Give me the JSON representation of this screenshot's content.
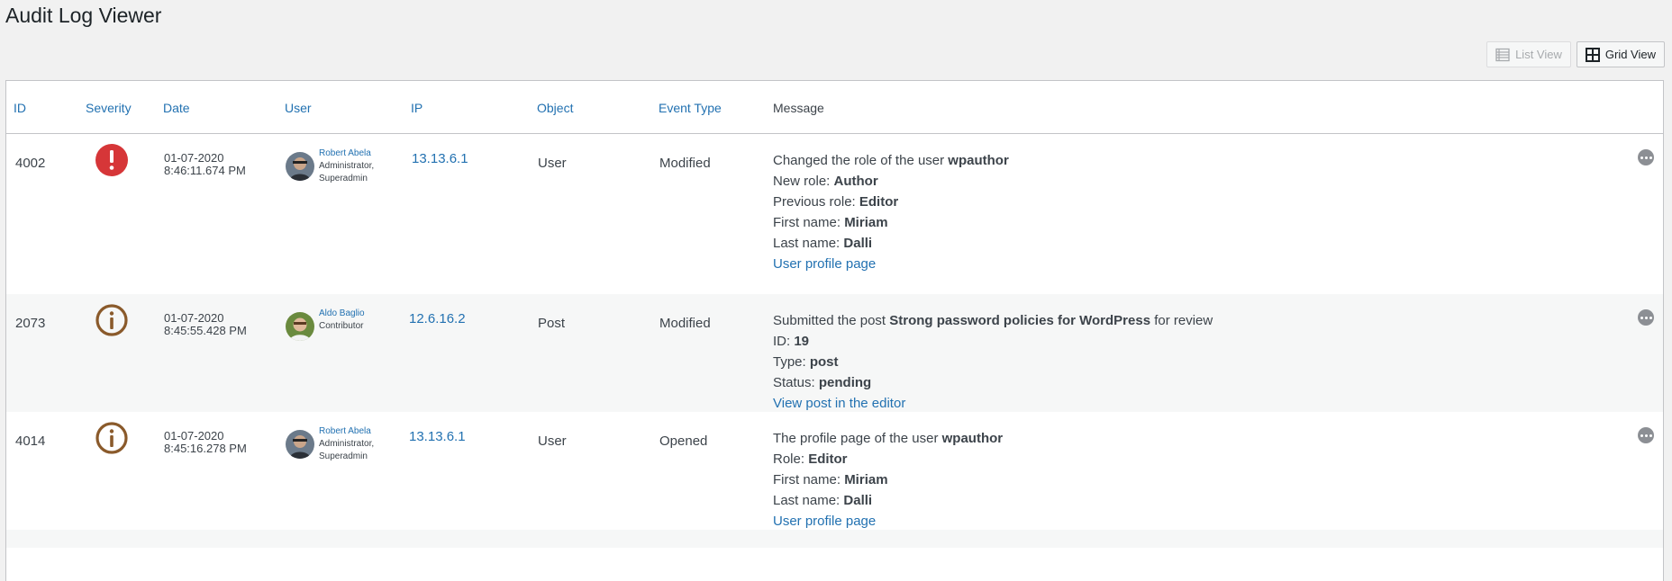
{
  "page": {
    "title": "Audit Log Viewer"
  },
  "view_switch": {
    "list_label": "List View",
    "grid_label": "Grid View",
    "active": "grid"
  },
  "columns": {
    "id": "ID",
    "severity": "Severity",
    "date": "Date",
    "user": "User",
    "ip": "IP",
    "object": "Object",
    "event_type": "Event Type",
    "message": "Message"
  },
  "colors": {
    "link": "#2271b1",
    "critical": "#d63638",
    "info": "#8a5a2b",
    "row_alt": "#f6f7f7"
  },
  "rows": [
    {
      "id": "4002",
      "severity_icon": "critical-icon",
      "date_line1": "01-07-2020",
      "date_line2": "8:46:11.674 PM",
      "user_name": "Robert Abela",
      "user_role1": "Administrator,",
      "user_role2": "Superadmin",
      "ip": "13.13.6.1",
      "object": "User",
      "event_type": "Modified",
      "msg": {
        "l1_prefix": "Changed the role of the user ",
        "l1_bold": "wpauthor",
        "l2_label": "New role: ",
        "l2_value": "Author",
        "l3_label": "Previous role: ",
        "l3_value": "Editor",
        "l4_label": "First name: ",
        "l4_value": "Miriam",
        "l5_label": "Last name: ",
        "l5_value": "Dalli",
        "link": "User profile page"
      }
    },
    {
      "id": "2073",
      "severity_icon": "info-icon",
      "date_line1": "01-07-2020",
      "date_line2": "8:45:55.428 PM",
      "user_name": "Aldo Baglio",
      "user_role1": "Contributor",
      "ip": "12.6.16.2",
      "object": "Post",
      "event_type": "Modified",
      "msg": {
        "l1_prefix": "Submitted the post ",
        "l1_bold": "Strong password policies for WordPress",
        "l1_suffix": " for review",
        "l2_label": "ID: ",
        "l2_value": "19",
        "l3_label": "Type: ",
        "l3_value": "post",
        "l4_label": "Status: ",
        "l4_value": "pending",
        "link": "View post in the editor"
      }
    },
    {
      "id": "4014",
      "severity_icon": "info-icon",
      "date_line1": "01-07-2020",
      "date_line2": "8:45:16.278 PM",
      "user_name": "Robert Abela",
      "user_role1": "Administrator,",
      "user_role2": "Superadmin",
      "ip": "13.13.6.1",
      "object": "User",
      "event_type": "Opened",
      "msg": {
        "l1_prefix": "The profile page of the user ",
        "l1_bold": "wpauthor",
        "l2_label": "Role: ",
        "l2_value": "Editor",
        "l3_label": "First name: ",
        "l3_value": "Miriam",
        "l4_label": "Last name: ",
        "l4_value": "Dalli",
        "link": "User profile page"
      }
    }
  ]
}
